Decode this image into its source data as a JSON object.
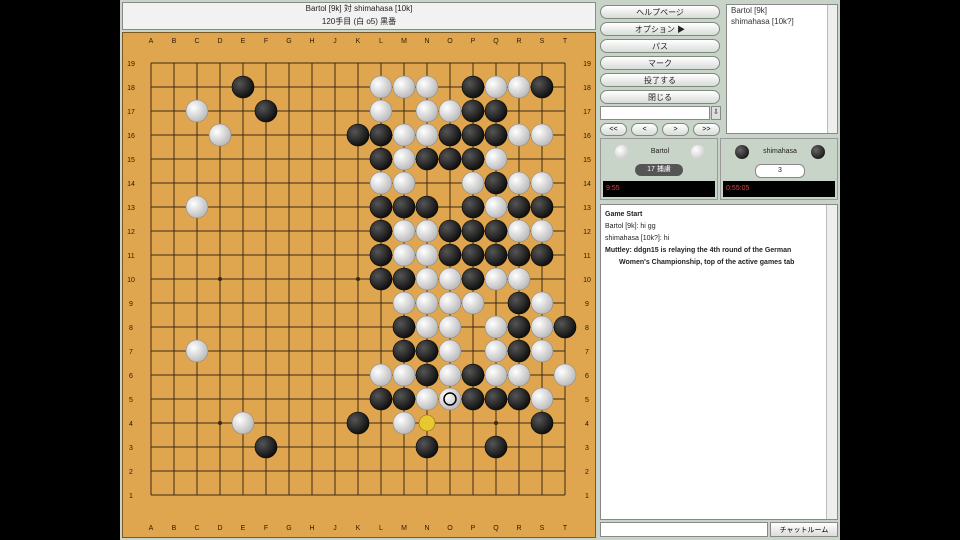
{
  "title": {
    "line1": "Bartol [9k] 対 shimahasa [10k]",
    "line2": "120手目 (白 o5) 黒番"
  },
  "board": {
    "columns": [
      "A",
      "B",
      "C",
      "D",
      "E",
      "F",
      "G",
      "H",
      "J",
      "K",
      "L",
      "M",
      "N",
      "O",
      "P",
      "Q",
      "R",
      "S",
      "T"
    ],
    "rows": [
      "19",
      "18",
      "17",
      "16",
      "15",
      "14",
      "13",
      "12",
      "11",
      "10",
      "9",
      "8",
      "7",
      "6",
      "5",
      "4",
      "3",
      "2",
      "1"
    ],
    "colors": {
      "board": "#e0a64f",
      "line": "#3a2a10",
      "black": "#111111",
      "white": "#f4f4f4",
      "highlight": "#e8c830"
    },
    "last_move": "O5",
    "hover_marker": "N4",
    "black_stones": [
      "E18",
      "F17",
      "K16",
      "L16",
      "M16",
      "N16",
      "O16",
      "P16",
      "Q16",
      "R16",
      "S16",
      "N17",
      "O17",
      "P17",
      "Q17",
      "R18",
      "S18",
      "Q18",
      "P18",
      "L15",
      "M15",
      "N15",
      "O15",
      "P15",
      "R16",
      "S16",
      "M14",
      "P14",
      "Q14",
      "L13",
      "M13",
      "N13",
      "P13",
      "Q13",
      "R13",
      "S13",
      "L12",
      "M12",
      "N12",
      "O12",
      "P12",
      "Q12",
      "R12",
      "S12",
      "L11",
      "O11",
      "P11",
      "Q11",
      "R11",
      "S11",
      "L10",
      "M10",
      "O10",
      "P10",
      "R9",
      "S9",
      "M8",
      "R8",
      "T8",
      "M7",
      "N7",
      "O7",
      "R7",
      "N6",
      "P6",
      "L5",
      "M5",
      "P5",
      "Q5",
      "R5",
      "K4",
      "S4",
      "F3",
      "N3",
      "Q3"
    ],
    "white_stones": [
      "C17",
      "D16",
      "L18",
      "M18",
      "N18",
      "Q18",
      "R18",
      "L17",
      "N17",
      "O17",
      "M16",
      "N16",
      "R16",
      "S16",
      "M15",
      "Q15",
      "P14",
      "R14",
      "S14",
      "L14",
      "M14",
      "C13",
      "Q13",
      "N12",
      "R12",
      "S12",
      "M12",
      "M11",
      "N11",
      "N10",
      "O10",
      "Q10",
      "R10",
      "O9",
      "P9",
      "M9",
      "N9",
      "S9",
      "N8",
      "O8",
      "Q8",
      "S8",
      "C7",
      "O7",
      "Q7",
      "S7",
      "L6",
      "M6",
      "O6",
      "Q6",
      "R6",
      "T6",
      "N5",
      "O5",
      "S5",
      "E4",
      "M4"
    ]
  },
  "buttons": {
    "help": "ヘルプページ",
    "options": "オプション ▶",
    "pass": "パス",
    "mark": "マーク",
    "resign": "投了する",
    "close": "閉じる",
    "nav": [
      "<<",
      "<",
      ">",
      ">>"
    ]
  },
  "players_list": [
    "Bartol [9k]",
    "shimahasa [10k?]"
  ],
  "player_left": {
    "name": "Bartol",
    "captures": "17 捕虜",
    "clock": "9:55",
    "color": "white"
  },
  "player_right": {
    "name": "shimahasa",
    "captures": "3",
    "clock": "0:55:05",
    "color": "black"
  },
  "chat": {
    "lines": [
      {
        "text": "Game Start",
        "bold": true
      },
      {
        "text": "Bartol [9k]: hi gg",
        "bold": false
      },
      {
        "text": "shimahasa [10k?]: hi",
        "bold": false
      },
      {
        "text": "Muttley: ddgn15 is relaying the 4th round of the German",
        "bold": true
      },
      {
        "text": "Women's Championship, top of the active games tab",
        "bold": true
      }
    ],
    "room_button": "チャットルーム"
  }
}
